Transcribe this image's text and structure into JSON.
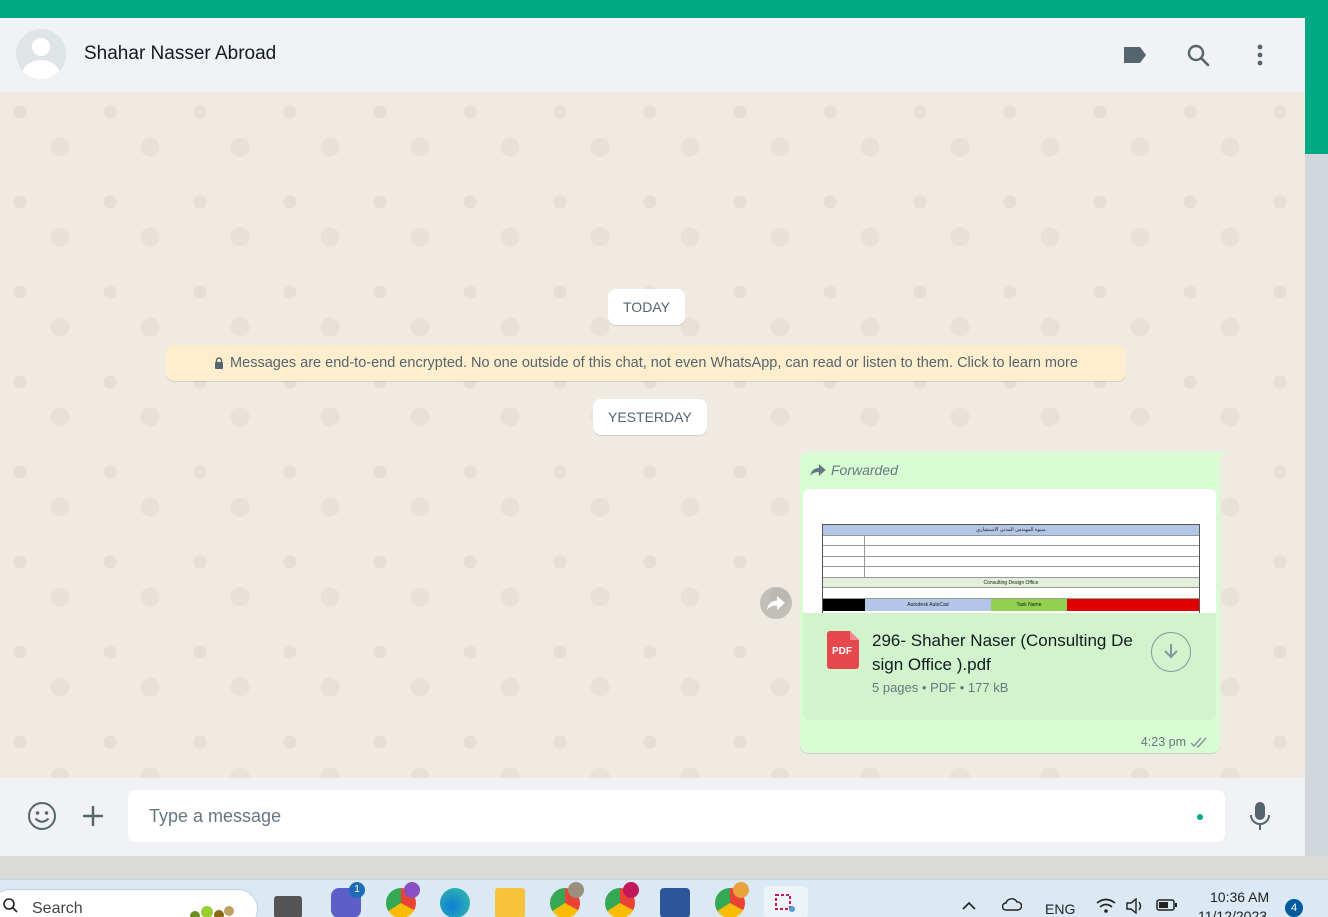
{
  "header": {
    "contact_name": "Shahar Nasser Abroad"
  },
  "chat": {
    "date_today": "TODAY",
    "encryption_notice": "Messages are end-to-end encrypted. No one outside of this chat, not even WhatsApp, can read or listen to them. Click to learn more",
    "date_yesterday": "YESTERDAY",
    "message": {
      "forwarded_label": "Forwarded",
      "file_name": "296- Shaher Naser (Consulting Design Office ).pdf",
      "file_pages": "5 pages",
      "file_type": "PDF",
      "file_size": "177 kB",
      "sep": "•",
      "pdf_badge": "PDF",
      "time": "4:23 pm"
    },
    "preview": {
      "title": "منيوة المهندس المدني الاستشاري",
      "office_row": "Consulting Design Office",
      "app_name": "Autodesk AutoCad",
      "task_name": "Task Name"
    }
  },
  "composer": {
    "placeholder": "Type a message"
  },
  "taskbar": {
    "search_label": "Search",
    "teams_badge": "1",
    "lang": "ENG",
    "time": "10:36 AM",
    "date": "11/12/2023",
    "notifications": "4"
  },
  "colors": {
    "brand": "#00a884",
    "bubble_out": "#d9fdd3",
    "notice_bg": "#ffeecd"
  }
}
